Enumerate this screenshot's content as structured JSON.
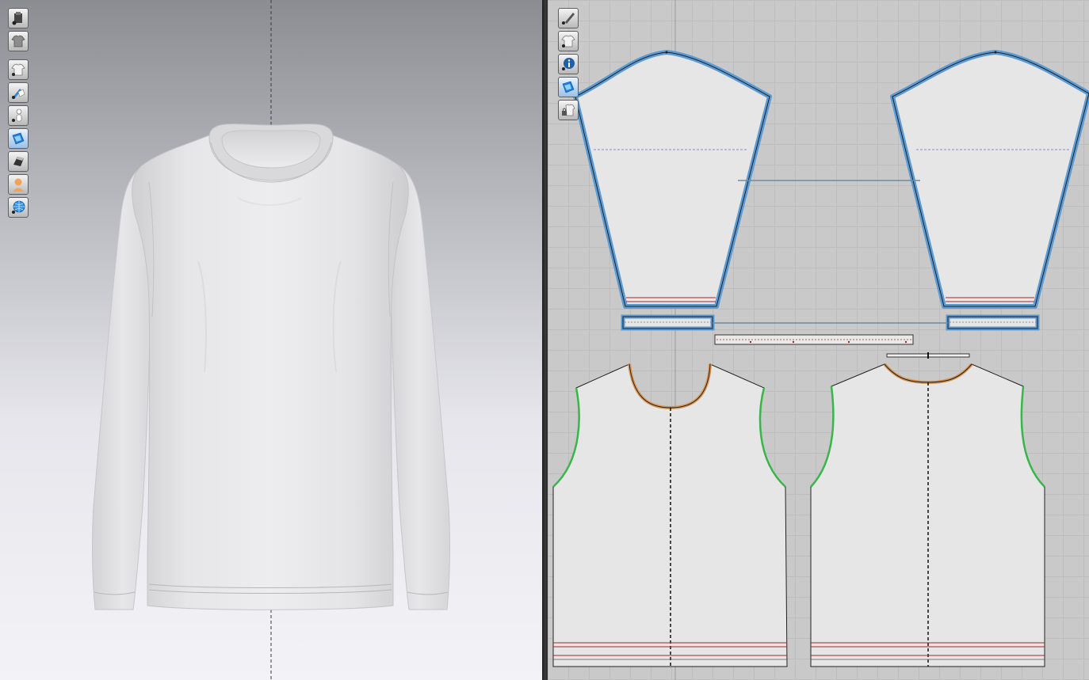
{
  "viewport_3d": {
    "background_top": "#8c8d92",
    "background_bottom": "#f3f3f7",
    "garment": "long-sleeve-crew-neck-t-shirt",
    "garment_color": "#e8e8e8",
    "toolbar": [
      {
        "icon": "show-avatar-icon"
      },
      {
        "icon": "show-garment-icon"
      },
      {
        "icon": "garment-display-icon"
      },
      {
        "icon": "texture-display-icon"
      },
      {
        "icon": "avatar-display-icon"
      },
      {
        "icon": "fabric-render-icon"
      },
      {
        "icon": "solid-view-icon"
      },
      {
        "icon": "avatar-skin-icon"
      },
      {
        "icon": "environment-globe-icon"
      }
    ]
  },
  "viewport_2d": {
    "grid_color": "#bdbdbd",
    "background": "#c9c9c9",
    "toolbar": [
      {
        "icon": "show-pattern-tool-icon"
      },
      {
        "icon": "show-garment-2d-icon"
      },
      {
        "icon": "pattern-info-icon"
      },
      {
        "icon": "fabric-2d-icon"
      },
      {
        "icon": "lock-pattern-icon"
      }
    ],
    "colors": {
      "selected_outline": "#5b9bd5",
      "neckline_seam": "#d99653",
      "armhole_seam": "#39b54a",
      "hem_line": "#9b2a2a",
      "sewing_line": "#6f8aa0"
    },
    "pattern_pieces": [
      {
        "name": "left-sleeve",
        "selected": true
      },
      {
        "name": "right-sleeve",
        "selected": true
      },
      {
        "name": "left-cuff",
        "selected": true
      },
      {
        "name": "right-cuff",
        "selected": true
      },
      {
        "name": "neck-rib-band",
        "selected": false
      },
      {
        "name": "neck-rib-band-back",
        "selected": false
      },
      {
        "name": "front-body",
        "selected": false
      },
      {
        "name": "back-body",
        "selected": false
      }
    ]
  }
}
